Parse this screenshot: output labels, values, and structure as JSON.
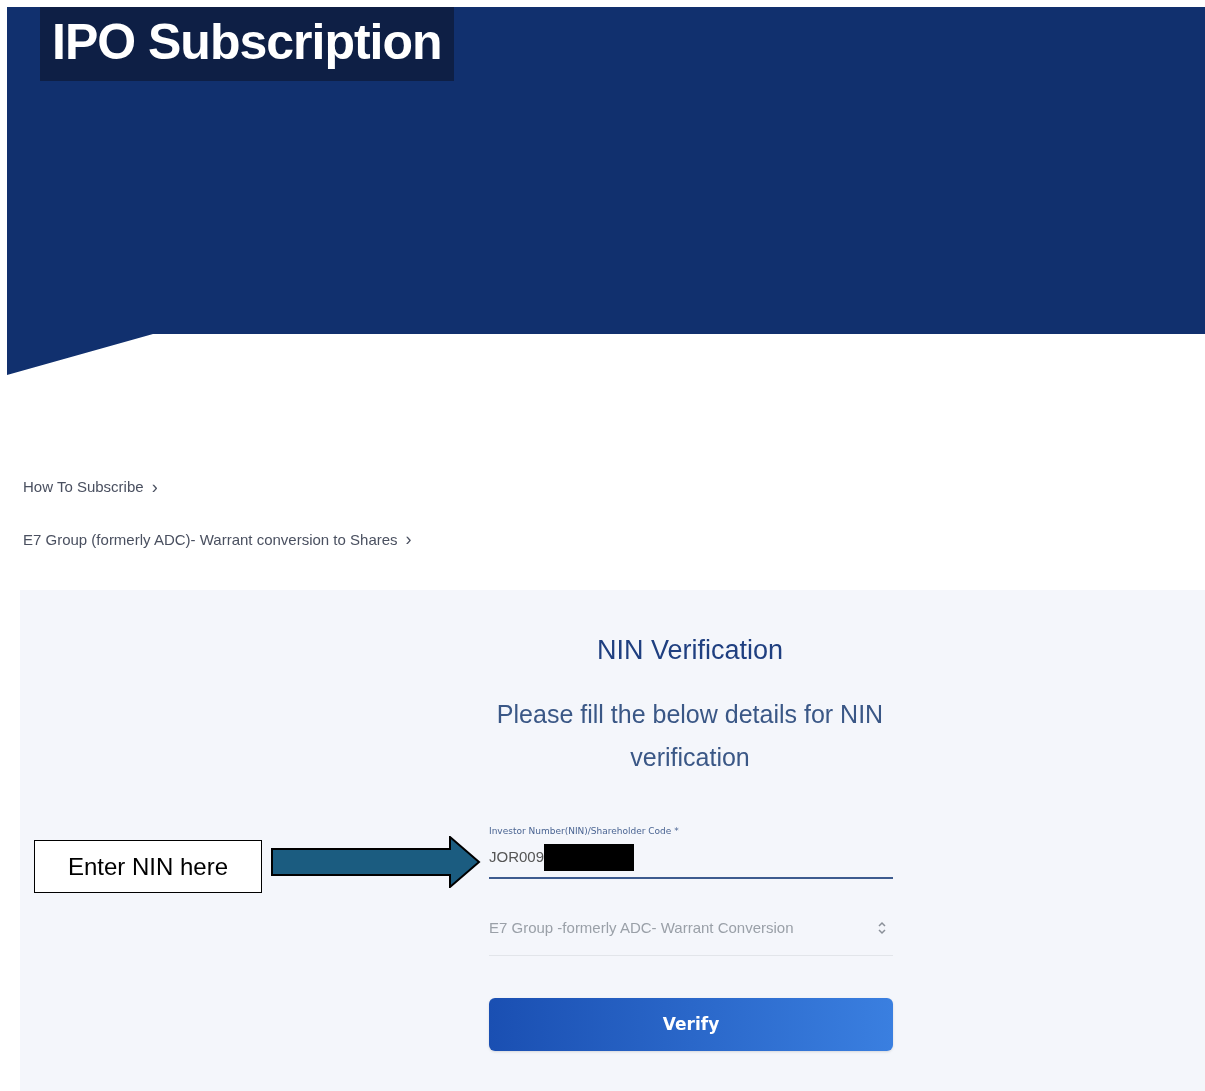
{
  "banner": {
    "title": "IPO Subscription"
  },
  "links": [
    {
      "label": "How To Subscribe",
      "icon": "›"
    },
    {
      "label": "E7 Group (formerly ADC)- Warrant conversion to Shares",
      "icon": "›"
    }
  ],
  "form": {
    "heading": "NIN Verification",
    "instructions": "Please fill the below details for NIN verification",
    "nin_field": {
      "label": "Investor Number(NIN)/Shareholder Code *",
      "value": "JOR009",
      "redacted": true
    },
    "offering_select": {
      "value": "E7 Group -formerly ADC- Warrant Conversion"
    },
    "button": "Verify"
  },
  "annotation": {
    "text": "Enter NIN here"
  }
}
